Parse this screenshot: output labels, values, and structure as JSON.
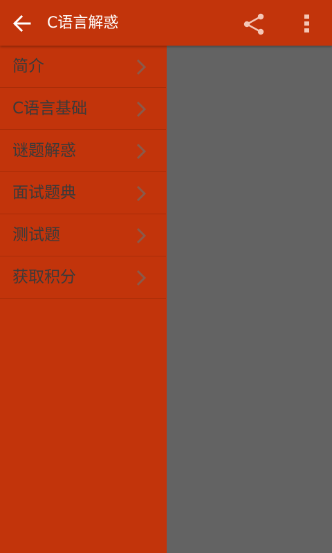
{
  "colors": {
    "primary": "#c2340b",
    "divider": "#a82c08",
    "scrim": "#636363",
    "item_text": "#3a3a3a",
    "title_text": "#ffffff",
    "share_icon": "#f4c6b6"
  },
  "toolbar": {
    "title": "C语言解惑",
    "back_icon": "arrow-left-icon",
    "share_icon": "share-icon",
    "overflow_icon": "more-vertical-icon"
  },
  "drawer": {
    "items": [
      {
        "label": "简介",
        "icon": "chevron-right-icon"
      },
      {
        "label": "C语言基础",
        "icon": "chevron-right-icon"
      },
      {
        "label": "谜题解惑",
        "icon": "chevron-right-icon"
      },
      {
        "label": "面试题典",
        "icon": "chevron-right-icon"
      },
      {
        "label": "测试题",
        "icon": "chevron-right-icon"
      },
      {
        "label": "获取积分",
        "icon": "chevron-right-icon"
      }
    ]
  }
}
